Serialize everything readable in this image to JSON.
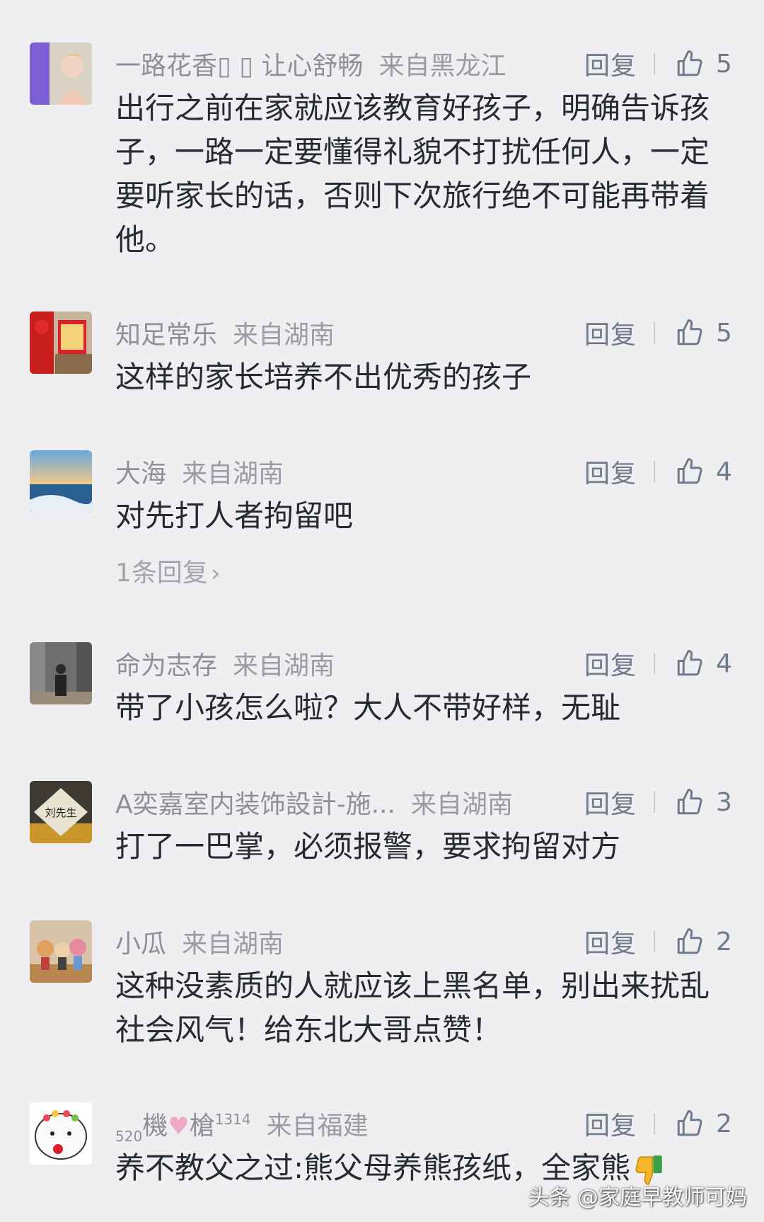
{
  "reply_label": "回复",
  "comments": [
    {
      "user": "一路花香",
      "user_suffix": "▯ ▯ 让心舒畅",
      "location": "来自黑龙江",
      "likes": "5",
      "text": "出行之前在家就应该教育好孩子，明确告诉孩子，一路一定要懂得礼貌不打扰任何人，一定要听家长的话，否则下次旅行绝不可能再带着他。"
    },
    {
      "user": "知足常乐",
      "location": "来自湖南",
      "likes": "5",
      "text": "这样的家长培养不出优秀的孩子"
    },
    {
      "user": "大海",
      "location": "来自湖南",
      "likes": "4",
      "text": "对先打人者拘留吧",
      "replies_link": "1条回复"
    },
    {
      "user": "命为志存",
      "location": "来自湖南",
      "likes": "4",
      "text": "带了小孩怎么啦？大人不带好样，无耻"
    },
    {
      "user": "A奕嘉室内装饰設計-施...",
      "location": "来自湖南",
      "likes": "3",
      "text": "打了一巴掌，必须报警，要求拘留对方",
      "avatar_text": "刘先生"
    },
    {
      "user": "小瓜",
      "location": "来自湖南",
      "likes": "2",
      "text": "这种没素质的人就应该上黑名单，别出来扰乱社会风气！给东北大哥点赞！"
    },
    {
      "user_prefix": "520",
      "user_a": "機",
      "user_heart": "♥",
      "user_b": "槍",
      "user_sup": "1314",
      "location": "来自福建",
      "likes": "2",
      "text": "养不教父之过:熊父母养熊孩纸，全家熊"
    }
  ],
  "watermark": "头条 @家庭早教师可妈",
  "colors": {
    "background": "#efeff1",
    "comment_text": "#262a33",
    "meta_text": "#8e9097",
    "action_text": "#6f7a8c"
  }
}
